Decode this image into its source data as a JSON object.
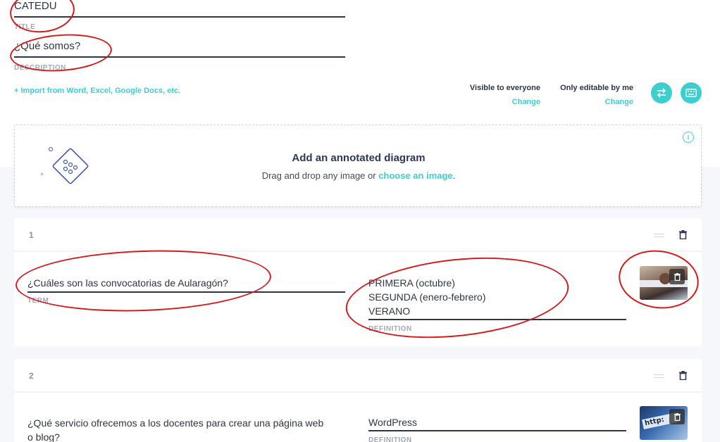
{
  "set": {
    "title_value": "CATEDU",
    "title_label": "TITLE",
    "description_value": "¿Qué somos?",
    "description_label": "DESCRIPTION",
    "import_link": "+ Import from Word, Excel, Google Docs, etc."
  },
  "visibility": {
    "visible_text": "Visible to everyone",
    "visible_change": "Change",
    "editable_text": "Only editable by me",
    "editable_change": "Change"
  },
  "toolbar": {
    "swap_icon": "swap-icon",
    "keyboard_icon": "keyboard-icon",
    "accent": "#3ccfcf"
  },
  "diagram": {
    "title": "Add an annotated diagram",
    "subtitle_prefix": "Drag and drop any image or ",
    "subtitle_link": "choose an image",
    "subtitle_suffix": "."
  },
  "cards": [
    {
      "number": "1",
      "term": "¿Cuáles son las convocatorias de Aularagón?",
      "term_label": "TERM",
      "definition_lines": [
        "PRIMERA (octubre)",
        "SEGUNDA (enero-febrero)",
        "VERANO"
      ],
      "definition_label": "DEFINITION"
    },
    {
      "number": "2",
      "term_line1": "¿Qué servicio ofrecemos a los docentes para crear una página web",
      "term_line2": "o blog?",
      "definition": "WordPress",
      "definition_label": "DEFINITION"
    }
  ]
}
